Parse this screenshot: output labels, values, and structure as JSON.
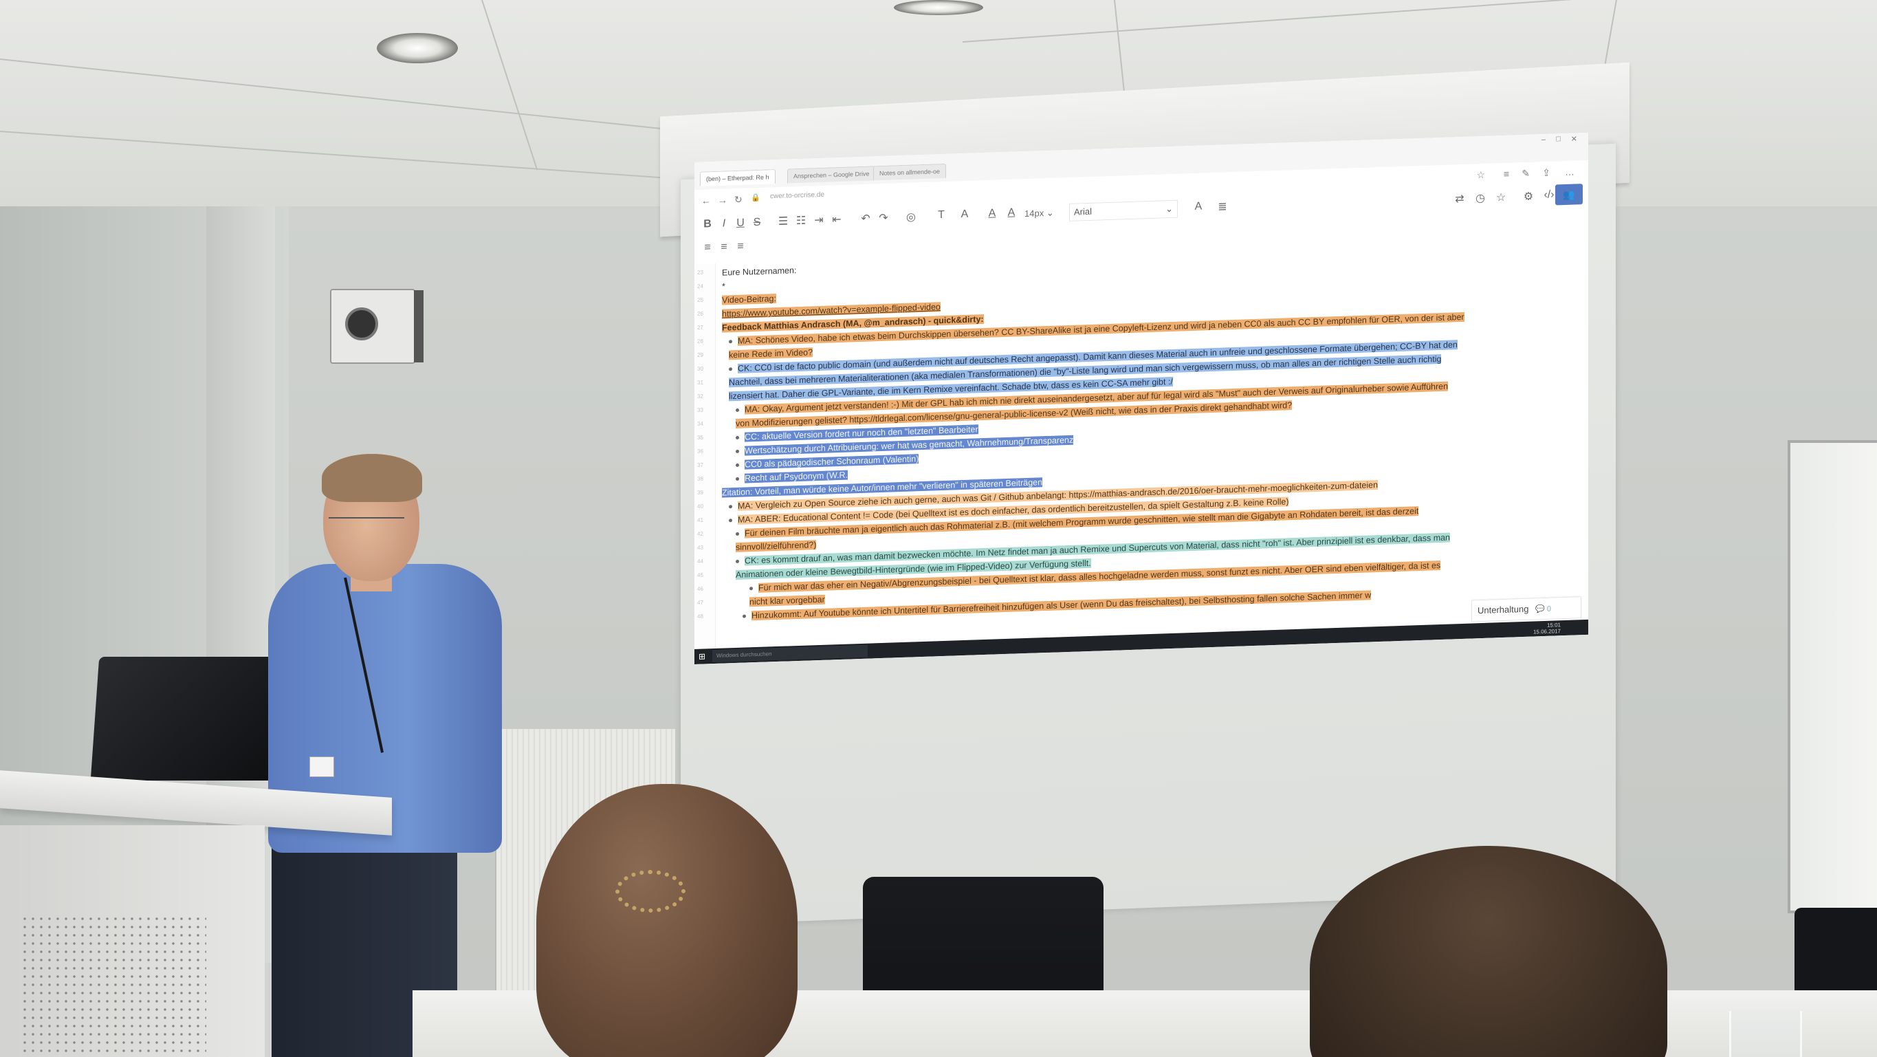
{
  "browser": {
    "tabs": [
      "(ben) – Etherpad: Re h",
      "Ansprechen – Google Drive",
      "Notes on allmende-oe"
    ],
    "url": "cwer.to-orcrise.de"
  },
  "toolbar": {
    "bold": "B",
    "italic": "I",
    "underline": "U",
    "strike": "S",
    "font_size": "14px",
    "font_family": "Arial",
    "font_size_chevron": "⌄",
    "font_family_chevron": "⌄"
  },
  "editor": {
    "line_numbers": [
      "23",
      "24",
      "25",
      "26",
      "27",
      "28",
      "29",
      "30",
      "31",
      "32",
      "33",
      "34",
      "35",
      "36",
      "37",
      "38",
      "39",
      "40",
      "41",
      "42",
      "43",
      "44",
      "45",
      "46",
      "47",
      "48"
    ],
    "lines": [
      {
        "text": "Eure Nutzernamen:",
        "style": ""
      },
      {
        "text": "*",
        "style": ""
      },
      {
        "text": "Video-Beitrag:",
        "style": "hl-orange"
      },
      {
        "text": "https://www.youtube.com/watch?v=example-flipped-video",
        "style": "hl-orange link"
      },
      {
        "text": "Feedback Matthias Andrasch (MA, @m_andrasch) - quick&dirty:",
        "style": "hl-orange bold"
      },
      {
        "text": "MA: Schönes Video, habe ich etwas beim Durchskippen übersehen? CC BY-ShareAlike ist ja eine Copyleft-Lizenz und wird ja neben CC0 als auch CC BY empfohlen für OER, von der ist aber",
        "style": "hl-orange"
      },
      {
        "text": "keine Rede im Video?",
        "style": "hl-orange"
      },
      {
        "text": "CK: CC0 ist de facto public domain (und außerdem nicht auf deutsches Recht angepasst). Damit kann dieses Material auch in unfreie und geschlossene Formate übergehen; CC-BY hat den",
        "style": "hl-blue"
      },
      {
        "text": "Nachteil, dass bei mehreren Materialiterationen (aka medialen Transformationen) die \"by\"-Liste lang wird und man sich vergewissern muss, ob man alles an der richtigen Stelle auch richtig",
        "style": "hl-blue"
      },
      {
        "text": "lizensiert hat. Daher die GPL-Variante, die im Kern Remixe vereinfacht. Schade btw, dass es kein CC-SA mehr gibt :/",
        "style": "hl-blue"
      },
      {
        "text": "MA: Okay, Argument jetzt verstanden! :-) Mit der GPL hab ich mich nie direkt auseinandergesetzt, aber auf für legal wird als \"Must\" auch der Verweis auf Originalurheber sowie Aufführen",
        "style": "hl-orange"
      },
      {
        "text": "von Modifizierungen gelistet? https://tldrlegal.com/license/gnu-general-public-license-v2 (Weiß nicht, wie das in der Praxis direkt gehandhabt wird?",
        "style": "hl-orange"
      },
      {
        "text": "CC: aktuelle Version fordert nur noch den \"letzten\" Bearbeiter",
        "style": "hl-darkblue"
      },
      {
        "text": "Wertschätzung durch Attribuierung: wer hat was gemacht, Wahrnehmung/Transparenz",
        "style": "hl-darkblue"
      },
      {
        "text": "CC0 als pädagodischer Schonraum (Valentin)",
        "style": "hl-darkblue"
      },
      {
        "text": "Recht auf Psydonym (W.R.",
        "style": "hl-darkblue"
      },
      {
        "text": "Zitation: Vorteil, man würde keine Autor/innen mehr \"verlieren\" in späteren Beiträgen",
        "style": "hl-darkblue"
      },
      {
        "text": "MA: Vergleich zu Open Source ziehe ich auch gerne, auch was Git / Github anbelangt: https://matthias-andrasch.de/2016/oer-braucht-mehr-moeglichkeiten-zum-dateien",
        "style": "hl-lightorange"
      },
      {
        "text": "MA: ABER: Educational Content != Code (bei Quelltext ist es doch einfacher, das ordentlich bereitzustellen, da spielt Gestaltung z.B. keine Rolle)",
        "style": "hl-lightorange"
      },
      {
        "text": "Für deinen Film bräuchte man ja eigentlich auch das Rohmaterial z.B. (mit welchem Programm wurde geschnitten, wie stellt man die Gigabyte an Rohdaten bereit, ist das derzeit",
        "style": "hl-orange"
      },
      {
        "text": "sinnvoll/zielführend?)",
        "style": "hl-orange"
      },
      {
        "text": "CK: es kommt drauf an, was man damit bezwecken möchte. Im Netz findet man ja auch Remixe und Supercuts von Material, dass nicht \"roh\" ist. Aber prinzipiell ist es denkbar, dass man",
        "style": "hl-teal"
      },
      {
        "text": "Animationen oder kleine Bewegtbild-Hintergründe (wie im Flipped-Video) zur Verfügung stellt.",
        "style": "hl-teal"
      },
      {
        "text": "Für mich war das eher ein Negativ/Abgrenzungsbeispiel - bei Quelltext ist klar, dass alles hochgeladne werden muss, sonst funzt es nicht. Aber OER sind eben vielfältiger, da ist es",
        "style": "hl-orange"
      },
      {
        "text": "nicht klar vorgebbar",
        "style": "hl-orange"
      },
      {
        "text": "Hinzukommt: Auf Youtube könnte ich Untertitel für Barrierefreiheit hinzufügen als User (wenn Du das freischaltest), bei Selbsthosting fallen solche Sachen immer w",
        "style": "hl-orange"
      }
    ]
  },
  "chat": {
    "label": "Unterhaltung",
    "count": "0"
  },
  "taskbar": {
    "search_placeholder": "Windows durchsuchen",
    "time": "15:01",
    "date": "15.06.2017"
  },
  "colors": {
    "orange": "#f0a760",
    "blue": "#8fb6e8",
    "dark_blue": "#5b83d6",
    "teal": "#9fd7cc",
    "users_button": "#4a76c9"
  }
}
